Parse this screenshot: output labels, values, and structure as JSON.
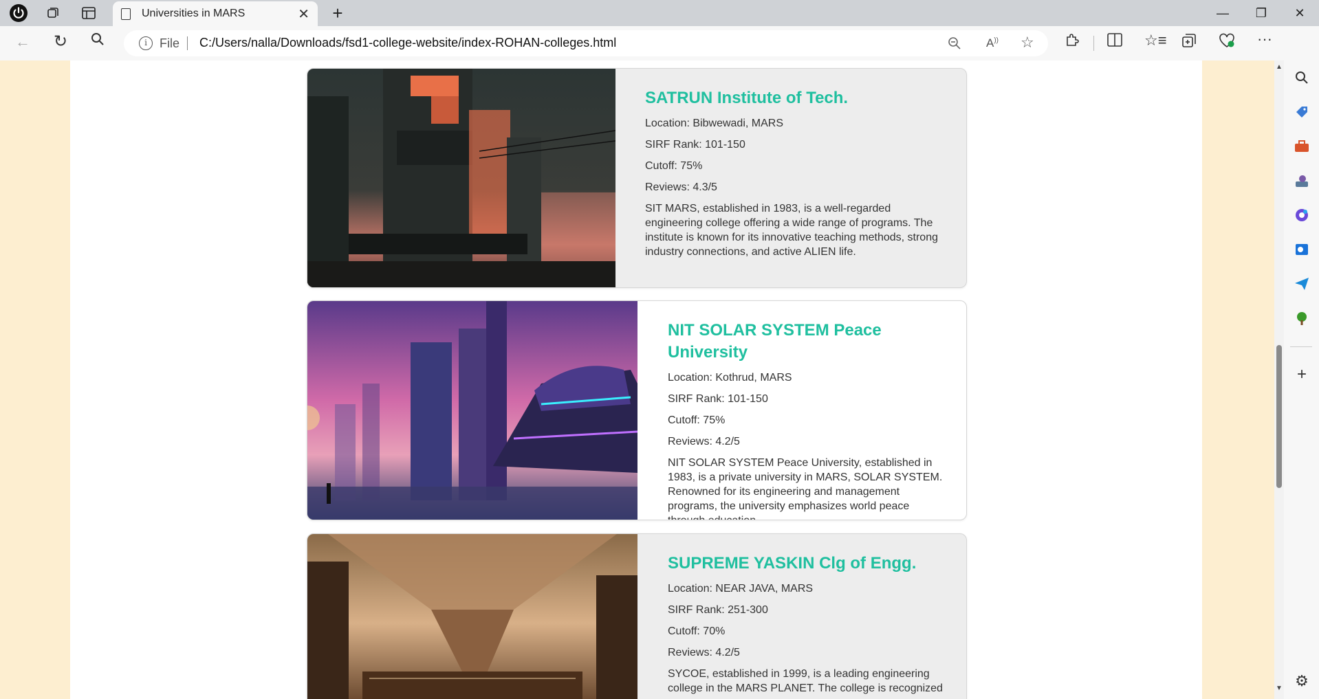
{
  "browser": {
    "tab_title": "Universities in MARS",
    "address_prefix": "File",
    "url": "C:/Users/nalla/Downloads/fsd1-college-website/index-ROHAN-colleges.html"
  },
  "colleges": [
    {
      "name": "SATRUN Institute of Tech.",
      "location": "Location: Bibwewadi, MARS",
      "rank": "SIRF Rank: 101-150",
      "cutoff": "Cutoff: 75%",
      "reviews": "Reviews: 4.3/5",
      "description": "SIT MARS, established in 1983, is a well-regarded engineering college offering a wide range of programs. The institute is known for its innovative teaching methods, strong industry connections, and active ALIEN life."
    },
    {
      "name": "NIT SOLAR SYSTEM Peace University",
      "location": "Location: Kothrud, MARS",
      "rank": "SIRF Rank: 101-150",
      "cutoff": "Cutoff: 75%",
      "reviews": "Reviews: 4.2/5",
      "description": "NIT SOLAR SYSTEM Peace University, established in 1983, is a private university in MARS, SOLAR SYSTEM. Renowned for its engineering and management programs, the university emphasizes world peace through education."
    },
    {
      "name": "SUPREME YASKIN Clg of Engg.",
      "location": "Location: NEAR JAVA, MARS",
      "rank": "SIRF Rank: 251-300",
      "cutoff": "Cutoff: 70%",
      "reviews": "Reviews: 4.2/5",
      "description": "SYCOE, established in 1999, is a leading engineering college in the MARS PLANET. The college is recognized"
    }
  ],
  "icons": {
    "browser_logo": "power-icon",
    "workspaces": "workspaces-icon",
    "tab_actions": "tab-actions-icon",
    "new_tab": "plus-icon",
    "back": "back-arrow-icon",
    "refresh": "refresh-icon",
    "search": "search-icon",
    "zoom": "zoom-out-icon",
    "read_aloud": "read-aloud-icon",
    "favorite": "star-icon",
    "extensions": "puzzle-icon",
    "split": "split-screen-icon",
    "favorites": "favorites-icon",
    "collections": "collections-icon",
    "health": "heart-icon",
    "more": "more-icon",
    "copilot": "copilot-icon"
  },
  "colors": {
    "accent": "#1fbf9f",
    "page_bg": "#fdeed0"
  }
}
